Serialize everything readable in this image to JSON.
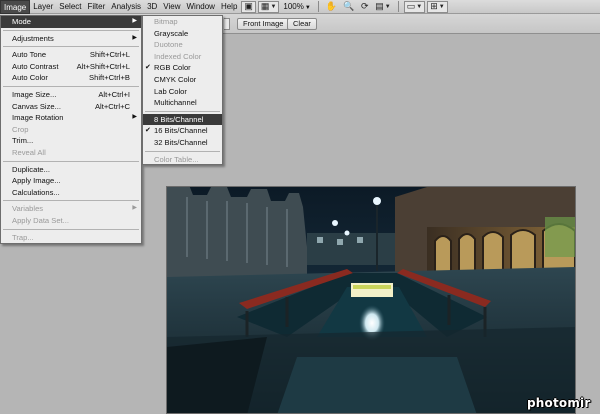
{
  "menubar": {
    "items": [
      "Image",
      "Layer",
      "Select",
      "Filter",
      "Analysis",
      "3D",
      "View",
      "Window",
      "Help"
    ],
    "active": "Image",
    "zoom": "100%"
  },
  "options_bar": {
    "front_image": "Front Image",
    "clear": "Clear"
  },
  "image_menu": [
    {
      "type": "item",
      "label": "Mode",
      "submenu": true,
      "highlighted": true
    },
    {
      "type": "sep"
    },
    {
      "type": "item",
      "label": "Adjustments",
      "submenu": true
    },
    {
      "type": "sep"
    },
    {
      "type": "item",
      "label": "Auto Tone",
      "shortcut": "Shift+Ctrl+L"
    },
    {
      "type": "item",
      "label": "Auto Contrast",
      "shortcut": "Alt+Shift+Ctrl+L"
    },
    {
      "type": "item",
      "label": "Auto Color",
      "shortcut": "Shift+Ctrl+B"
    },
    {
      "type": "sep"
    },
    {
      "type": "item",
      "label": "Image Size...",
      "shortcut": "Alt+Ctrl+I"
    },
    {
      "type": "item",
      "label": "Canvas Size...",
      "shortcut": "Alt+Ctrl+C"
    },
    {
      "type": "item",
      "label": "Image Rotation",
      "submenu": true
    },
    {
      "type": "item",
      "label": "Crop",
      "disabled": true
    },
    {
      "type": "item",
      "label": "Trim..."
    },
    {
      "type": "item",
      "label": "Reveal All",
      "disabled": true
    },
    {
      "type": "sep"
    },
    {
      "type": "item",
      "label": "Duplicate..."
    },
    {
      "type": "item",
      "label": "Apply Image..."
    },
    {
      "type": "item",
      "label": "Calculations..."
    },
    {
      "type": "sep"
    },
    {
      "type": "item",
      "label": "Variables",
      "submenu": true,
      "disabled": true
    },
    {
      "type": "item",
      "label": "Apply Data Set...",
      "disabled": true
    },
    {
      "type": "sep"
    },
    {
      "type": "item",
      "label": "Trap...",
      "disabled": true
    }
  ],
  "mode_menu": [
    {
      "type": "item",
      "label": "Bitmap",
      "disabled": true
    },
    {
      "type": "item",
      "label": "Grayscale"
    },
    {
      "type": "item",
      "label": "Duotone",
      "disabled": true
    },
    {
      "type": "item",
      "label": "Indexed Color",
      "disabled": true
    },
    {
      "type": "item",
      "label": "RGB Color",
      "checked": true
    },
    {
      "type": "item",
      "label": "CMYK Color"
    },
    {
      "type": "item",
      "label": "Lab Color"
    },
    {
      "type": "item",
      "label": "Multichannel"
    },
    {
      "type": "sep"
    },
    {
      "type": "item",
      "label": "8 Bits/Channel",
      "highlighted": true
    },
    {
      "type": "item",
      "label": "16 Bits/Channel",
      "checked": true
    },
    {
      "type": "item",
      "label": "32 Bits/Channel"
    },
    {
      "type": "sep"
    },
    {
      "type": "item",
      "label": "Color Table...",
      "disabled": true
    }
  ],
  "watermark": "photomir",
  "colors": {
    "menu_highlight": "#3a3a3a",
    "menu_bg": "#ededed",
    "workspace": "#b5b5b5"
  }
}
